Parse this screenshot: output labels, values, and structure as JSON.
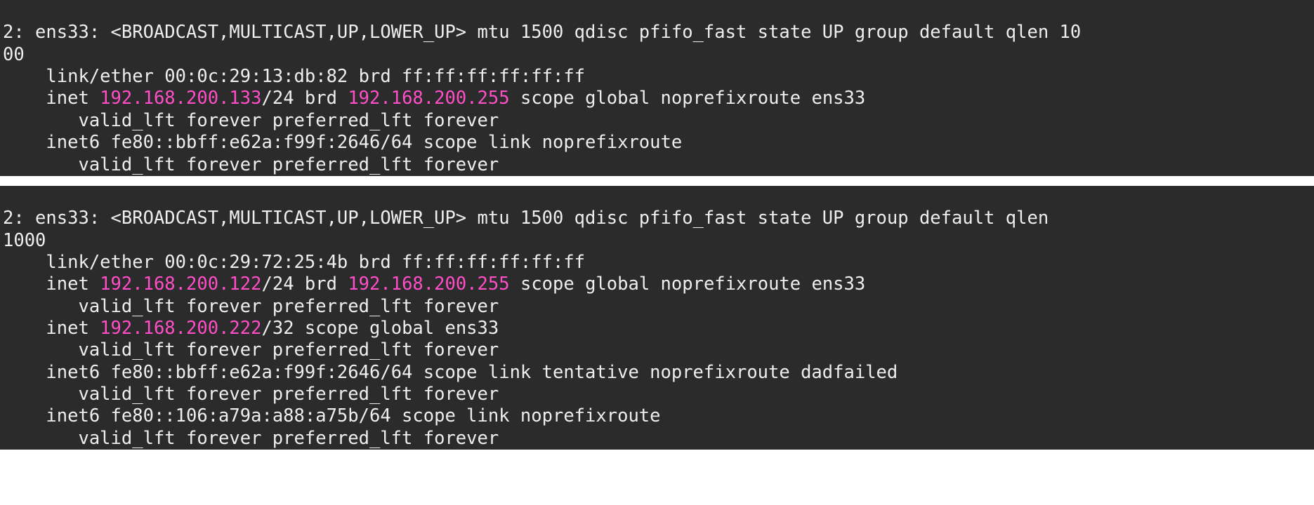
{
  "block1": {
    "header_a": "2: ens33: <BROADCAST,MULTICAST,UP,LOWER_UP> mtu 1500 qdisc pfifo_fast state UP group default qlen 10",
    "header_b": "00",
    "link": "    link/ether 00:0c:29:13:db:82 brd ff:ff:ff:ff:ff:ff",
    "inet_pre": "    inet ",
    "inet_ip": "192.168.200.133",
    "inet_mid": "/24 brd ",
    "inet_brd": "192.168.200.255",
    "inet_post": " scope global noprefixroute ens33",
    "inet_lft": "       valid_lft forever preferred_lft forever",
    "inet6": "    inet6 fe80::bbff:e62a:f99f:2646/64 scope link noprefixroute ",
    "inet6_lft": "       valid_lft forever preferred_lft forever"
  },
  "block2": {
    "header_a": "2: ens33: <BROADCAST,MULTICAST,UP,LOWER_UP> mtu 1500 qdisc pfifo_fast state UP group default qlen ",
    "header_b": "1000",
    "link": "    link/ether 00:0c:29:72:25:4b brd ff:ff:ff:ff:ff:ff",
    "inet1_pre": "    inet ",
    "inet1_ip": "192.168.200.122",
    "inet1_mid": "/24 brd ",
    "inet1_brd": "192.168.200.255",
    "inet1_post": " scope global noprefixroute ens33",
    "inet1_lft": "       valid_lft forever preferred_lft forever",
    "inet2_pre": "    inet ",
    "inet2_ip": "192.168.200.222",
    "inet2_post": "/32 scope global ens33",
    "inet2_lft": "       valid_lft forever preferred_lft forever",
    "inet6a": "    inet6 fe80::bbff:e62a:f99f:2646/64 scope link tentative noprefixroute dadfailed ",
    "inet6a_lft": "       valid_lft forever preferred_lft forever",
    "inet6b": "    inet6 fe80::106:a79a:a88:a75b/64 scope link noprefixroute ",
    "inet6b_lft": "       valid_lft forever preferred_lft forever"
  }
}
